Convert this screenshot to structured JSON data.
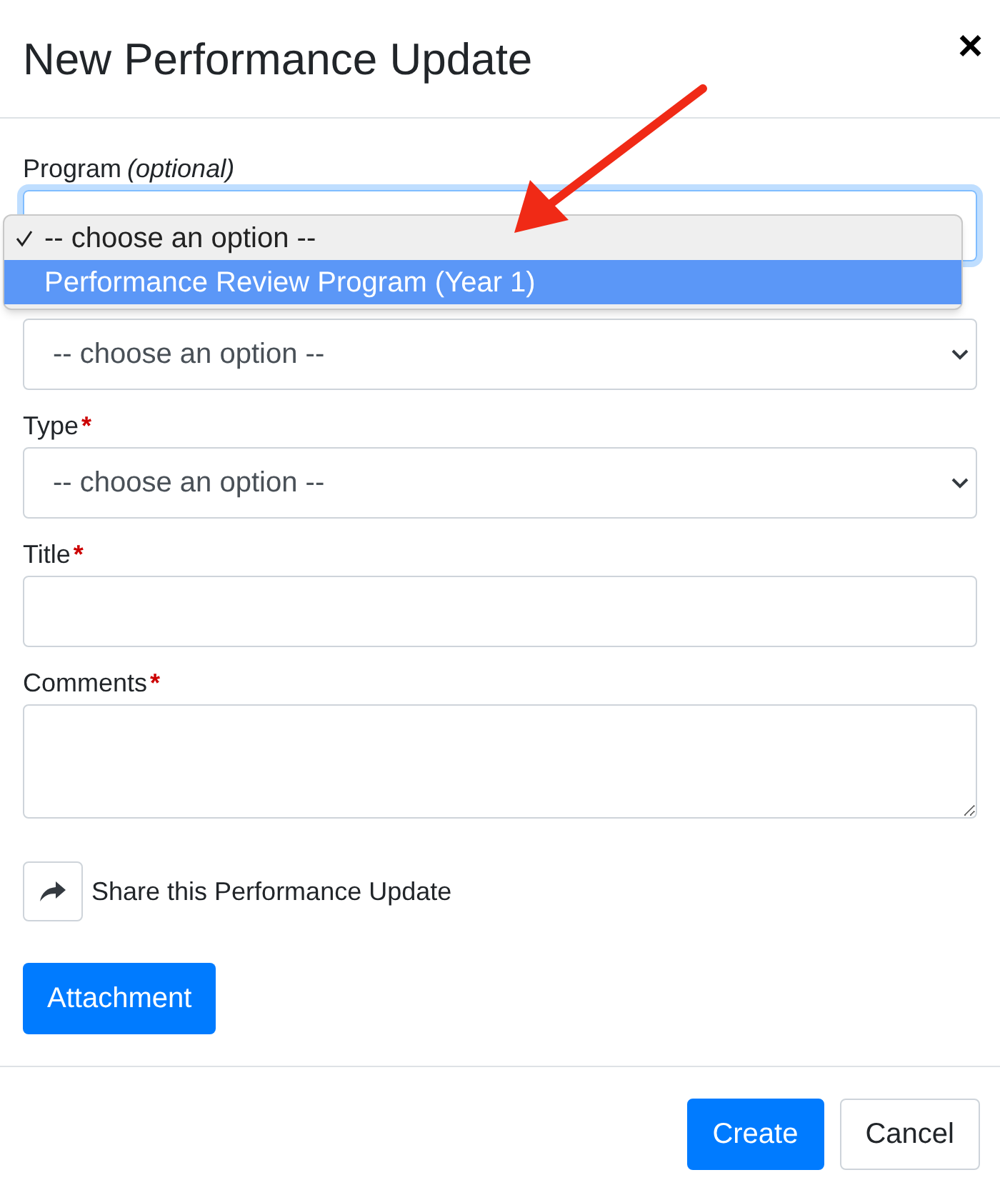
{
  "dialog": {
    "title": "New Performance Update",
    "close": "×"
  },
  "fields": [
    {
      "kind": "select",
      "label": "Program",
      "note": "(optional)",
      "focused": true
    },
    {
      "kind": "select",
      "value": "-- choose an option --",
      "focused": false
    },
    {
      "kind": "select",
      "label": "Type",
      "required_mark": "*",
      "value": "-- choose an option --",
      "focused": false
    },
    {
      "kind": "input",
      "label": "Title",
      "required_mark": "*",
      "focused": false
    },
    {
      "kind": "textarea",
      "label": "Comments",
      "required_mark": "*",
      "focused": false
    }
  ],
  "dropdown": {
    "options": [
      {
        "label": "-- choose an option --",
        "checked": true,
        "highlighted": false
      },
      {
        "label": "Performance Review Program (Year 1)",
        "checked": false,
        "highlighted": true
      }
    ]
  },
  "share": {
    "label": "Share this Performance Update"
  },
  "attachment_button": "Attachment",
  "footer": {
    "buttons": [
      {
        "label": "Create",
        "kind": "primary"
      },
      {
        "label": "Cancel",
        "kind": "secondary"
      }
    ]
  }
}
